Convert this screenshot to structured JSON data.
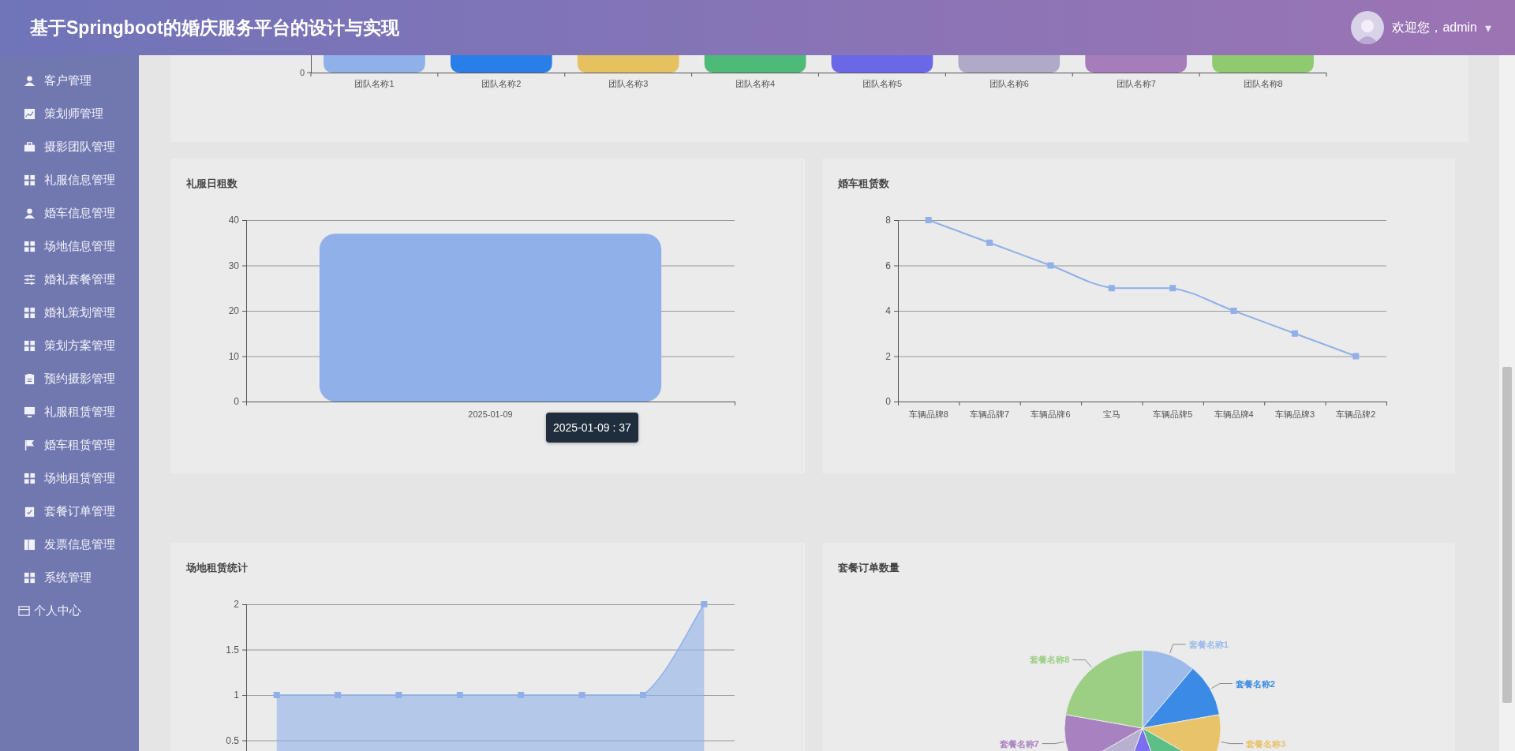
{
  "header": {
    "title": "基于Springboot的婚庆服务平台的设计与实现",
    "greeting": "欢迎您，admin",
    "caret": "▾"
  },
  "sidebar": {
    "items": [
      {
        "label": "客户管理",
        "kind": "module"
      },
      {
        "label": "策划师管理",
        "kind": "module"
      },
      {
        "label": "摄影团队管理",
        "kind": "module"
      },
      {
        "label": "礼服信息管理",
        "kind": "module"
      },
      {
        "label": "婚车信息管理",
        "kind": "module"
      },
      {
        "label": "场地信息管理",
        "kind": "module"
      },
      {
        "label": "婚礼套餐管理",
        "kind": "module"
      },
      {
        "label": "婚礼策划管理",
        "kind": "module"
      },
      {
        "label": "策划方案管理",
        "kind": "module"
      },
      {
        "label": "预约摄影管理",
        "kind": "module"
      },
      {
        "label": "礼服租赁管理",
        "kind": "module"
      },
      {
        "label": "婚车租赁管理",
        "kind": "module"
      },
      {
        "label": "场地租赁管理",
        "kind": "module"
      },
      {
        "label": "套餐订单管理",
        "kind": "module"
      },
      {
        "label": "发票信息管理",
        "kind": "module"
      },
      {
        "label": "系统管理",
        "kind": "module"
      },
      {
        "label": "个人中心",
        "kind": "link"
      }
    ]
  },
  "team_chart": {
    "y_tick": "0",
    "bars": [
      {
        "label": "团队名称1",
        "color": "#8fb0e8"
      },
      {
        "label": "团队名称2",
        "color": "#2a7ee8"
      },
      {
        "label": "团队名称3",
        "color": "#e6c160"
      },
      {
        "label": "团队名称4",
        "color": "#4dba78"
      },
      {
        "label": "团队名称5",
        "color": "#6b68e8"
      },
      {
        "label": "团队名称6",
        "color": "#b0aac8"
      },
      {
        "label": "团队名称7",
        "color": "#a77cba"
      },
      {
        "label": "团队名称8",
        "color": "#8ecb70"
      }
    ]
  },
  "charts": [
    {
      "title": "礼服日租数",
      "tooltip": "2025-01-09 : 37",
      "chart_data": {
        "type": "bar",
        "categories": [
          "2025-01-09"
        ],
        "series": [
          {
            "color": "#8fb0e8",
            "values": [
              37
            ]
          }
        ],
        "grid": true,
        "ylim": [
          0,
          40
        ],
        "yticks": [
          0,
          10,
          20,
          30,
          40
        ]
      }
    },
    {
      "title": "婚车租赁数",
      "chart_data": {
        "type": "line",
        "categories": [
          "车辆品牌8",
          "车辆品牌7",
          "车辆品牌6",
          "宝马",
          "车辆品牌5",
          "车辆品牌4",
          "车辆品牌3",
          "车辆品牌2"
        ],
        "series": [
          {
            "color": "#8fb0e8",
            "marker": "square",
            "values": [
              8,
              7,
              6,
              5,
              5,
              4,
              3,
              2
            ]
          }
        ],
        "grid": true,
        "ylim": [
          0,
          8
        ],
        "yticks": [
          0,
          2,
          4,
          6,
          8
        ]
      }
    },
    {
      "title": "场地租赁统计",
      "chart_data": {
        "type": "area",
        "series": [
          {
            "color": "#8fb0e8",
            "marker": "square",
            "values": [
              1,
              1,
              1,
              1,
              1,
              1,
              1,
              2
            ]
          }
        ],
        "grid": true,
        "ylim": [
          0,
          2
        ],
        "yticks": [
          0.5,
          1,
          1.5,
          2
        ]
      }
    }
  ],
  "pie_panel": {
    "title": "套餐订单数量",
    "slices": [
      {
        "label": "套餐名称1",
        "color": "#9cbaea"
      },
      {
        "label": "套餐名称2",
        "color": "#3b8be6"
      },
      {
        "label": "套餐名称3",
        "color": "#e8c36a"
      },
      {
        "color": "#5bbf86"
      },
      {
        "color": "#7b6ef0"
      },
      {
        "color": "#b8b0d0"
      },
      {
        "label": "套餐名称7",
        "color": "#a882c0"
      },
      {
        "label": "套餐名称8",
        "color": "#9ccf84"
      }
    ]
  }
}
